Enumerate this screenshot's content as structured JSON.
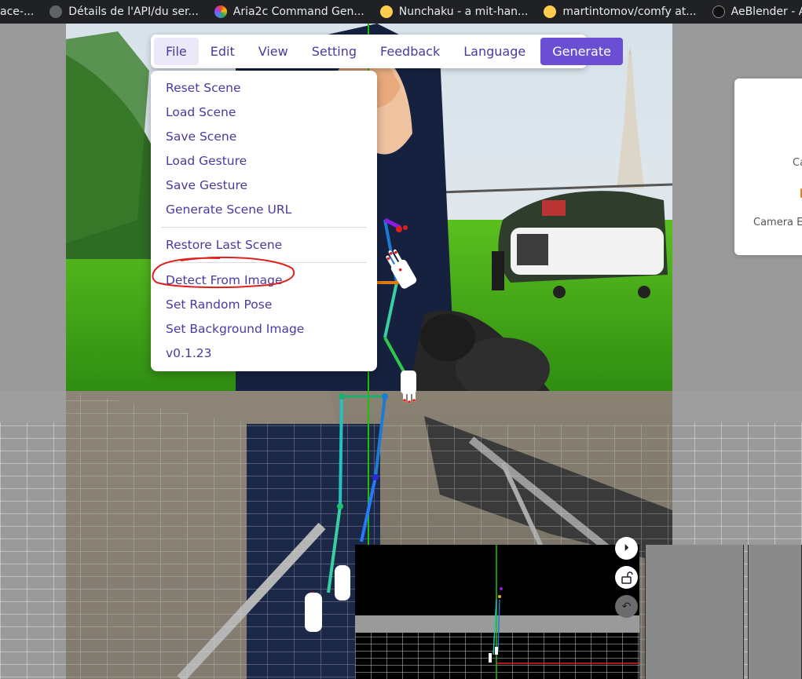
{
  "bookmarks": [
    {
      "label": "ace-...",
      "icon": "bookmark-icon"
    },
    {
      "label": "Détails de l'API/du ser...",
      "icon": "github-icon"
    },
    {
      "label": "Aria2c Command Gen...",
      "icon": "rainbow-icon"
    },
    {
      "label": "Nunchaku - a mit-han...",
      "icon": "huggingface-icon"
    },
    {
      "label": "martintomov/comfy at...",
      "icon": "huggingface-icon"
    },
    {
      "label": "AeBlender - After Effe",
      "icon": "skull-icon"
    }
  ],
  "menubar": {
    "items": [
      "File",
      "Edit",
      "View",
      "Setting",
      "Feedback",
      "Language"
    ],
    "active": "File",
    "generate_label": "Generate"
  },
  "file_menu": {
    "group1": [
      "Reset Scene",
      "Load Scene",
      "Save Scene",
      "Load Gesture",
      "Save Gesture",
      "Generate Scene URL"
    ],
    "group2": [
      "Restore Last Scene"
    ],
    "group3": [
      "Detect From Image",
      "Set Random Pose",
      "Set Background Image",
      "v0.1.23"
    ],
    "highlighted": "Detect From Image"
  },
  "side_panel": {
    "line1": "Ca",
    "line2": "Camera Eff"
  },
  "preview_controls": [
    "play-step-icon",
    "unlock-icon",
    "undo-icon"
  ],
  "colors": {
    "accent": "#6a4fd4",
    "menu_text": "#4a3aa0",
    "annotation": "#e0201c",
    "body_line": "#1ec000"
  }
}
